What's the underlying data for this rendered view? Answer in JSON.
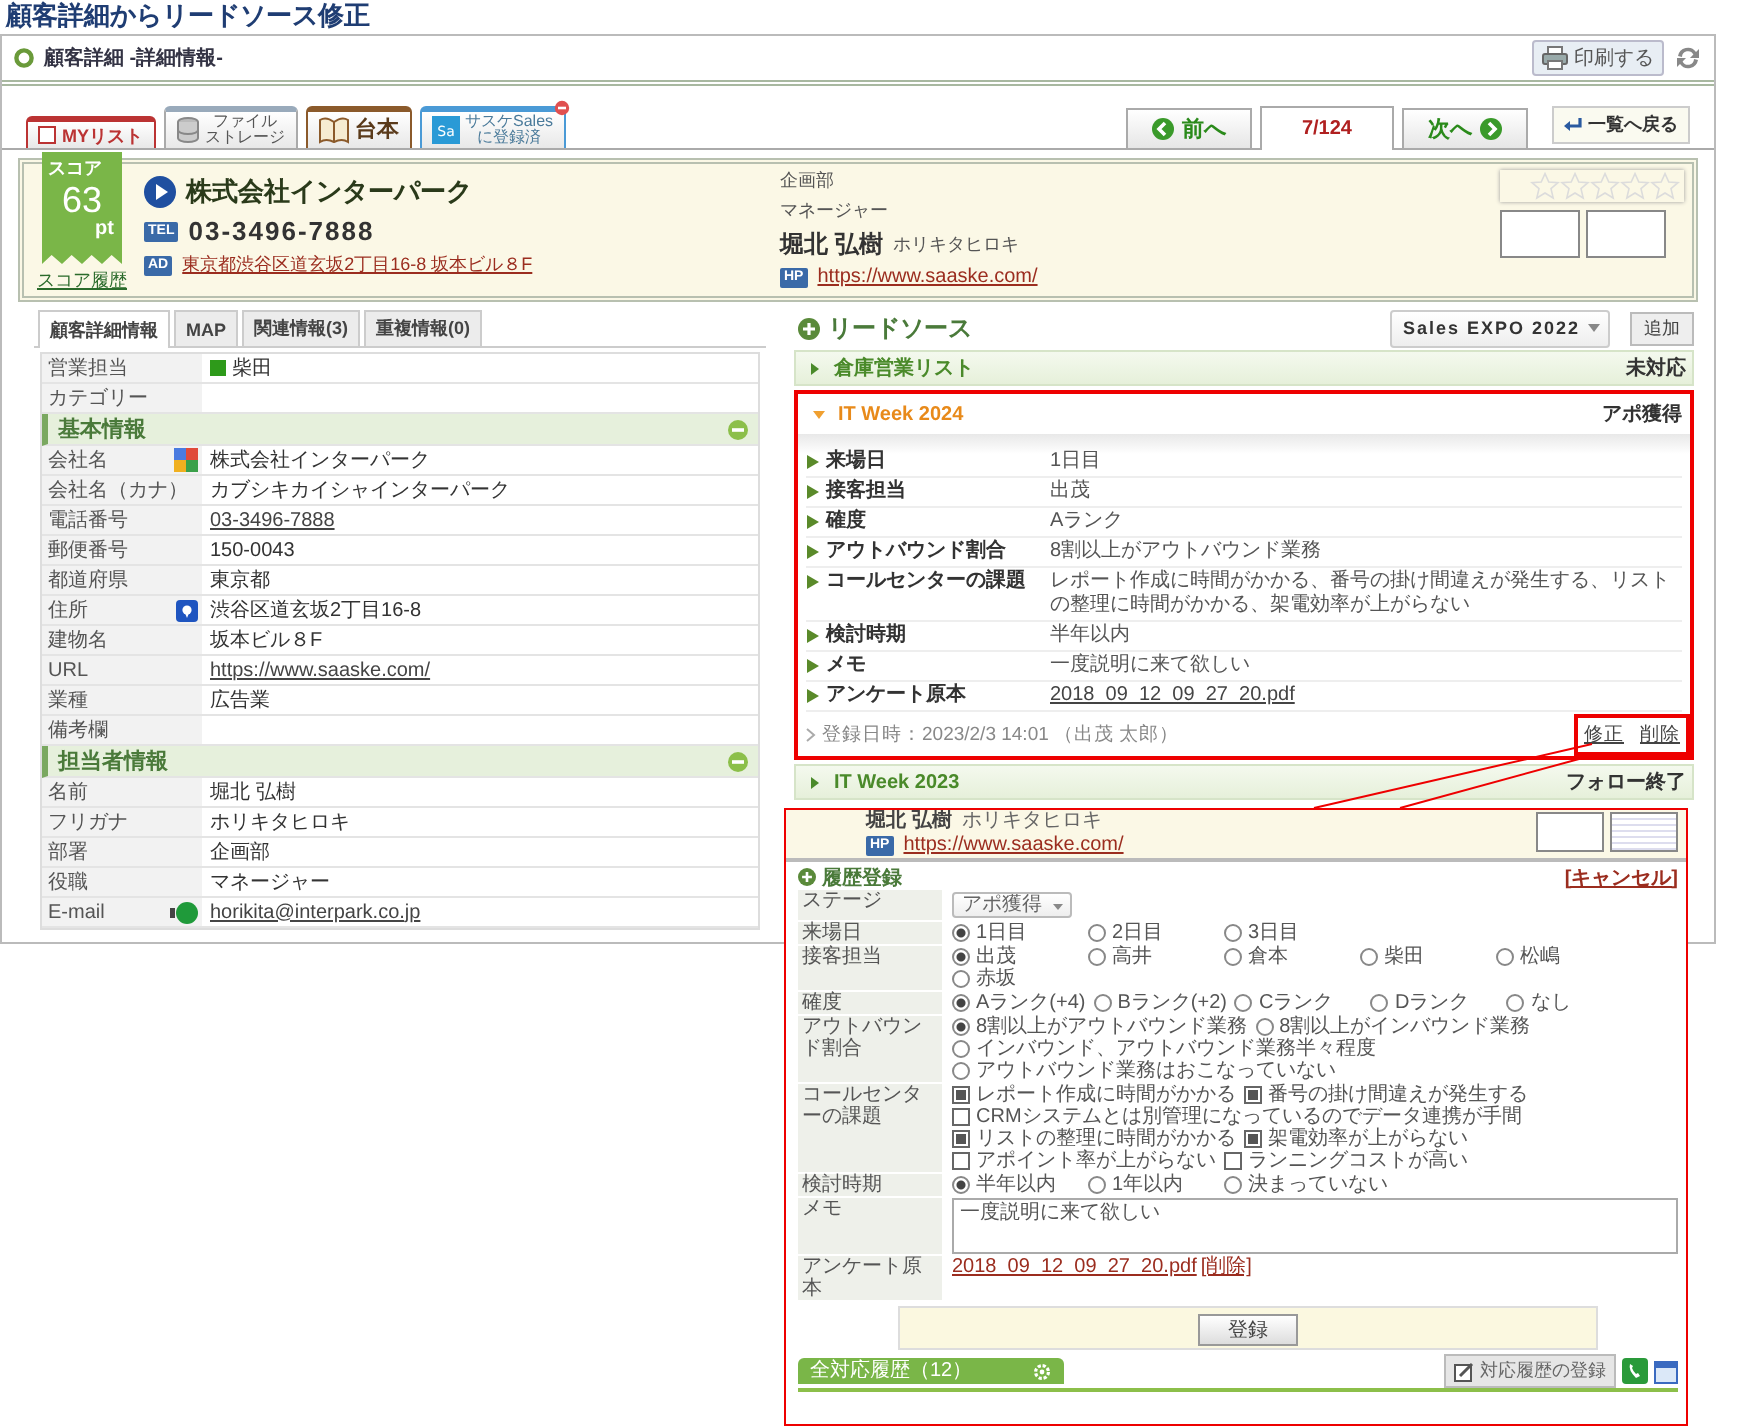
{
  "page_title": "顧客詳細からリードソース修正",
  "header": {
    "title": "顧客詳細 -詳細情報-",
    "print_button": "印刷する"
  },
  "tabs": [
    {
      "kind": "mylist",
      "lines": [
        "MYリスト"
      ],
      "checked": false
    },
    {
      "kind": "files",
      "lines": [
        "ファイル",
        "ストレージ"
      ]
    },
    {
      "kind": "script",
      "lines": [
        "台本"
      ]
    },
    {
      "kind": "sales",
      "icon_text": "Sa",
      "lines": [
        "サスケSales",
        "に登録済"
      ]
    }
  ],
  "nav": [
    {
      "kind": "prev",
      "label": "前へ",
      "selected": false
    },
    {
      "kind": "position",
      "label": "7/124",
      "selected": true
    },
    {
      "kind": "next",
      "label": "次へ",
      "selected": false
    }
  ],
  "back_button": "一覧へ戻る",
  "customer": {
    "score_label": "スコア",
    "score": "63",
    "score_unit": "pt",
    "score_history": "スコア履歴",
    "company": "株式会社インターパーク",
    "tel_label": "TEL",
    "tel": "03-3496-7888",
    "address_label": "AD",
    "address": "東京都渋谷区道玄坂2丁目16-8 坂本ビル８F",
    "department": "企画部",
    "position": "マネージャー",
    "contact_name": "堀北 弘樹",
    "contact_kana": "ホリキタヒロキ",
    "hp_label": "HP",
    "url": "https://www.saaske.com/",
    "stars": 0
  },
  "detail_tabs": [
    {
      "label": "顧客詳細情報",
      "selected": true
    },
    {
      "label": "MAP",
      "selected": false
    },
    {
      "label": "関連情報(3)",
      "selected": false
    },
    {
      "label": "重複情報(0)",
      "selected": false
    }
  ],
  "detail_rows": [
    {
      "kind": "field",
      "label": "営業担当",
      "value": "柴田",
      "color": "#2e9a1a"
    },
    {
      "kind": "field",
      "label": "カテゴリー"
    },
    {
      "kind": "section",
      "label": "基本情報",
      "expanded": true
    },
    {
      "kind": "searchfield",
      "label": "会社名",
      "value": "株式会社インターパーク"
    },
    {
      "kind": "field",
      "label": "会社名（カナ）",
      "value": "カブシキカイシャインターパーク"
    },
    {
      "kind": "field",
      "label": "電話番号",
      "value": "03-3496-7888",
      "link": true
    },
    {
      "kind": "field",
      "label": "郵便番号",
      "value": "150-0043"
    },
    {
      "kind": "field",
      "label": "都道府県",
      "value": "東京都"
    },
    {
      "kind": "mapfield",
      "label": "住所",
      "value": "渋谷区道玄坂2丁目16-8"
    },
    {
      "kind": "field",
      "label": "建物名",
      "value": "坂本ビル８F"
    },
    {
      "kind": "field",
      "label": "URL",
      "value": "https://www.saaske.com/",
      "link": true
    },
    {
      "kind": "field",
      "label": "業種",
      "value": "広告業"
    },
    {
      "kind": "field",
      "label": "備考欄"
    },
    {
      "kind": "section",
      "label": "担当者情報",
      "expanded": true
    },
    {
      "kind": "field",
      "label": "名前",
      "value": "堀北 弘樹"
    },
    {
      "kind": "field",
      "label": "フリガナ",
      "value": "ホリキタヒロキ"
    },
    {
      "kind": "field",
      "label": "部署",
      "value": "企画部"
    },
    {
      "kind": "field",
      "label": "役職",
      "value": "マネージャー"
    },
    {
      "kind": "mailfield",
      "label": "E-mail",
      "value": "horikita@interpark.co.jp",
      "link": true
    }
  ],
  "lead_source": {
    "title": "リードソース",
    "select": "Sales EXPO 2022",
    "add_button": "追加",
    "items": [
      {
        "name": "倉庫営業リスト",
        "status": "未対応",
        "expanded": false,
        "highlighted": false
      },
      {
        "name": "IT Week 2024",
        "status": "アポ獲得",
        "expanded": true,
        "highlighted": true,
        "fields": [
          {
            "label": "来場日",
            "value": "1日目"
          },
          {
            "label": "接客担当",
            "value": "出茂"
          },
          {
            "label": "確度",
            "value": "Aランク"
          },
          {
            "label": "アウトバウンド割合",
            "value": "8割以上がアウトバウンド業務"
          },
          {
            "label": "コールセンターの課題",
            "value": "レポート作成に時間がかかる、番号の掛け間違えが発生する、リストの整理に時間がかかる、架電効率が上がらない"
          },
          {
            "label": "検討時期",
            "value": "半年以内"
          },
          {
            "label": "メモ",
            "value": "一度説明に来て欲しい"
          },
          {
            "label": "アンケート原本",
            "value": "2018_09_12_09_27_20.pdf",
            "link": true
          }
        ],
        "registered": "登録日時：2023/2/3 14:01 （出茂 太郎）",
        "actions": [
          "修正",
          "削除"
        ],
        "actions_highlighted": true
      },
      {
        "name": "IT Week 2023",
        "status": "フォロー終了",
        "expanded": false,
        "highlighted": false
      }
    ]
  },
  "inset": {
    "contact_name": "堀北 弘樹",
    "contact_kana": "ホリキタヒロキ",
    "hp_label": "HP",
    "url": "https://www.saaske.com/",
    "form_title": "履歴登録",
    "cancel": "[キャンセル]",
    "rows": [
      {
        "kind": "select",
        "label": "ステージ",
        "value": "アポ獲得"
      },
      {
        "kind": "radio",
        "label": "来場日",
        "options": [
          {
            "label": "1日目",
            "selected": true
          },
          {
            "label": "2日目",
            "selected": false
          },
          {
            "label": "3日目",
            "selected": false
          }
        ]
      },
      {
        "kind": "radio",
        "label": "接客担当",
        "options": [
          {
            "label": "出茂",
            "selected": true
          },
          {
            "label": "高井",
            "selected": false
          },
          {
            "label": "倉本",
            "selected": false
          },
          {
            "label": "柴田",
            "selected": false
          },
          {
            "label": "松嶋",
            "selected": false
          },
          {
            "label": "赤坂",
            "selected": false
          }
        ]
      },
      {
        "kind": "radio",
        "label": "確度",
        "options": [
          {
            "label": "Aランク(+4)",
            "selected": true
          },
          {
            "label": "Bランク(+2)",
            "selected": false
          },
          {
            "label": "Cランク",
            "selected": false
          },
          {
            "label": "Dランク",
            "selected": false
          },
          {
            "label": "なし",
            "selected": false
          }
        ]
      },
      {
        "kind": "radio",
        "label": "アウトバウンド割合",
        "options": [
          {
            "label": "8割以上がアウトバウンド業務",
            "selected": true
          },
          {
            "label": "8割以上がインバウンド業務",
            "selected": false
          },
          {
            "label": "インバウンド、アウトバウンド業務半々程度",
            "selected": false
          },
          {
            "label": "アウトバウンド業務はおこなっていない",
            "selected": false
          }
        ]
      },
      {
        "kind": "checkbox",
        "label": "コールセンターの課題",
        "options": [
          {
            "label": "レポート作成に時間がかかる",
            "checked": true
          },
          {
            "label": "番号の掛け間違えが発生する",
            "checked": true
          },
          {
            "label": "CRMシステムとは別管理になっているのでデータ連携が手間",
            "checked": false
          },
          {
            "label": "リストの整理に時間がかかる",
            "checked": true
          },
          {
            "label": "架電効率が上がらない",
            "checked": true
          },
          {
            "label": "アポイント率が上がらない",
            "checked": false
          },
          {
            "label": "ランニングコストが高い",
            "checked": false
          }
        ]
      },
      {
        "kind": "radio",
        "label": "検討時期",
        "options": [
          {
            "label": "半年以内",
            "selected": true
          },
          {
            "label": "1年以内",
            "selected": false
          },
          {
            "label": "決まっていない",
            "selected": false
          }
        ]
      },
      {
        "kind": "textarea",
        "label": "メモ",
        "value": "一度説明に来て欲しい"
      },
      {
        "kind": "file",
        "label": "アンケート原本",
        "value": "2018_09_12_09_27_20.pdf",
        "delete": "[削除]"
      }
    ],
    "submit": "登録",
    "history_tab": "全対応履歴（12）",
    "history_button": "対応履歴の登録"
  }
}
